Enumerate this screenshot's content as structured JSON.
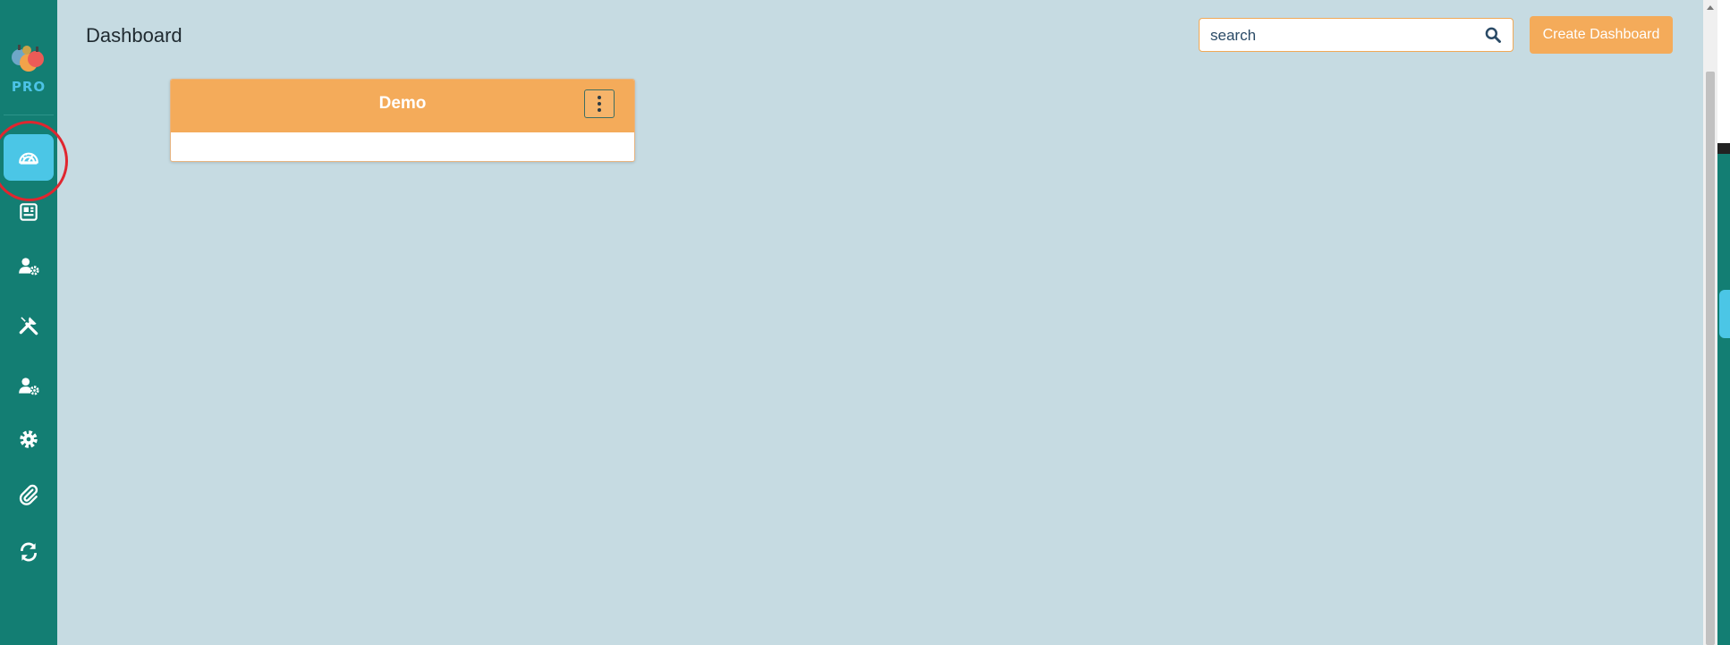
{
  "app": {
    "logo_text": "PRO"
  },
  "sidebar": {
    "items": [
      {
        "name": "dashboard",
        "icon": "gauge-icon",
        "active": true
      },
      {
        "name": "reports",
        "icon": "newspaper-icon",
        "active": false
      },
      {
        "name": "user-settings",
        "icon": "user-gear-icon",
        "active": false
      },
      {
        "name": "tools",
        "icon": "tools-icon",
        "active": false
      },
      {
        "name": "user-admin",
        "icon": "user-gear-icon",
        "active": false
      },
      {
        "name": "settings",
        "icon": "gear-icon",
        "active": false
      },
      {
        "name": "attachments",
        "icon": "paperclip-icon",
        "active": false
      },
      {
        "name": "sync",
        "icon": "sync-icon",
        "active": false
      }
    ]
  },
  "header": {
    "title": "Dashboard",
    "search_placeholder": "search",
    "create_button_label": "Create Dashboard"
  },
  "dashboards": [
    {
      "title": "Demo"
    }
  ],
  "colors": {
    "sidebar": "#137e73",
    "accent": "#f4ab5a",
    "active_nav": "#4bc6e6",
    "background": "#c6dbe2",
    "annotation": "#e0262f"
  }
}
